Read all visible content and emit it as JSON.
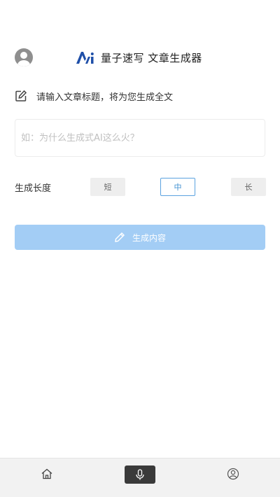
{
  "header": {
    "app_title": "量子速写 文章生成器",
    "logo_icon": "ai-logo-icon",
    "avatar_icon": "user-avatar-icon"
  },
  "prompt": {
    "icon": "edit-icon",
    "text": "请输入文章标题，将为您生成全文"
  },
  "title_input": {
    "value": "",
    "placeholder": "如：为什么生成式AI这么火？"
  },
  "length": {
    "label": "生成长度",
    "options": [
      "短",
      "中",
      "长"
    ],
    "selected": "中"
  },
  "generate": {
    "icon": "pencil-icon",
    "label": "生成内容"
  },
  "tabbar": {
    "tabs": [
      {
        "name": "home",
        "icon": "home-icon"
      },
      {
        "name": "voice",
        "icon": "microphone-icon"
      },
      {
        "name": "profile",
        "icon": "user-icon"
      }
    ]
  },
  "colors": {
    "accent": "#3d8fd1",
    "generate_button": "#a3cdf5",
    "logo_blue": "#1f4fa8"
  }
}
